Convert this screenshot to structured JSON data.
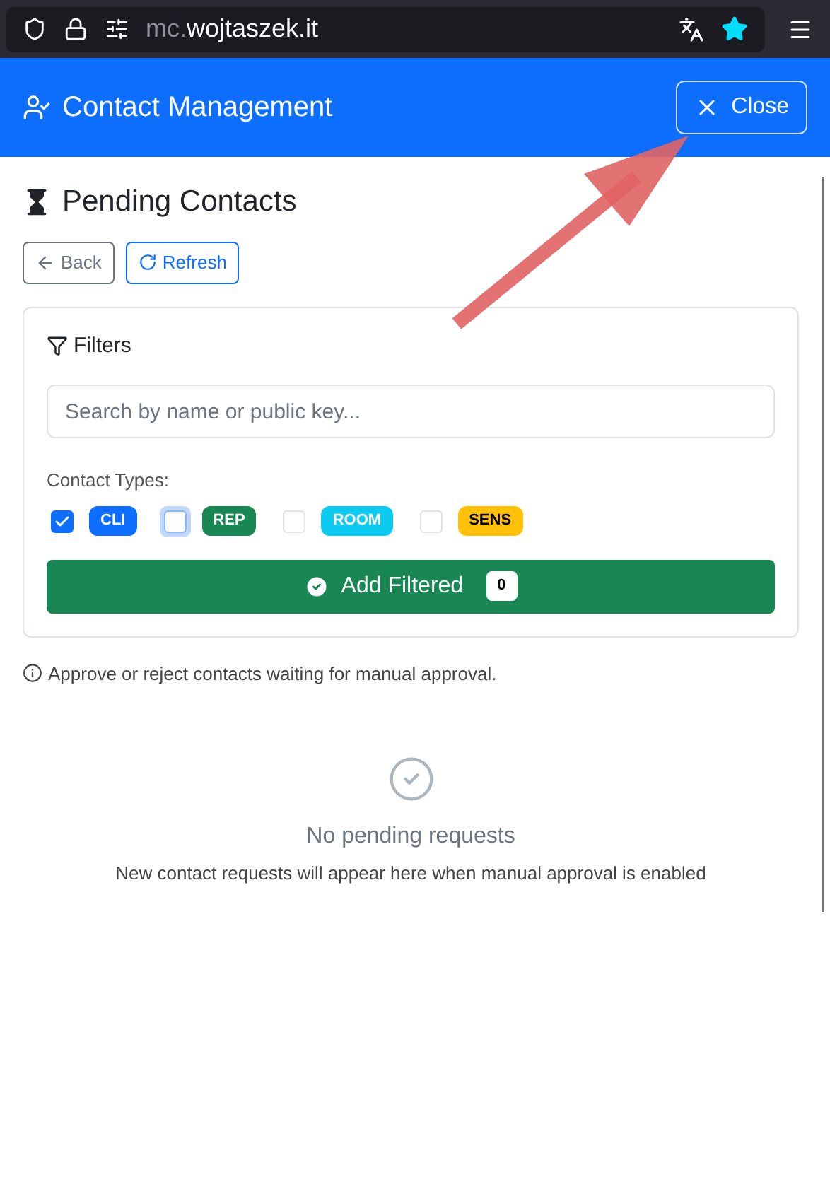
{
  "browser": {
    "url_prefix": "mc.",
    "url_domain": "wojtaszek.it",
    "bookmarked": true
  },
  "header": {
    "title": "Contact Management",
    "close_label": "Close"
  },
  "page": {
    "title": "Pending Contacts",
    "back_label": "Back",
    "refresh_label": "Refresh"
  },
  "filters": {
    "title": "Filters",
    "search": {
      "placeholder": "Search by name or public key..."
    },
    "types_label": "Contact Types:",
    "types": [
      {
        "label": "CLI",
        "checked": true,
        "focused": false,
        "color": "#0d6efd"
      },
      {
        "label": "REP",
        "checked": false,
        "focused": true,
        "color": "#198754"
      },
      {
        "label": "ROOM",
        "checked": false,
        "focused": false,
        "color": "#0dcaf0"
      },
      {
        "label": "SENS",
        "checked": false,
        "focused": false,
        "color": "#ffc107"
      }
    ],
    "add_button": {
      "label": "Add Filtered",
      "count": "0"
    }
  },
  "info": "Approve or reject contacts waiting for manual approval.",
  "empty": {
    "title": "No pending requests",
    "text": "New contact requests will appear here when manual approval is enabled"
  }
}
